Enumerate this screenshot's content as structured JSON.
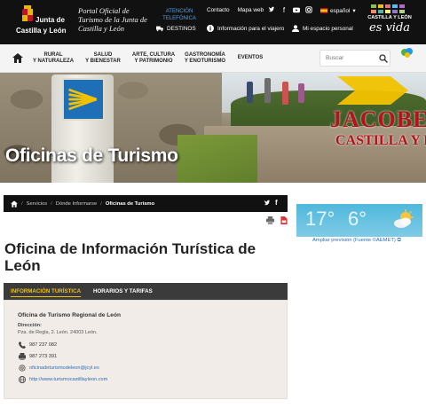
{
  "header": {
    "logo_line1": "Junta de",
    "logo_line2": "Castilla y León",
    "portal_text": "Portal Oficial de Turismo de la Junta de Castilla y León",
    "atencion": "ATENCIÓN TELEFÓNICA",
    "links": [
      "Contacto",
      "Mapa web"
    ],
    "language": "español",
    "destinos": "DESTINOS",
    "viajero": "Información para el viajero",
    "espacio": "Mi espacio personal",
    "brand_line1": "CASTILLA Y LEÓN",
    "brand_line2": "es vida",
    "social_icons": [
      "twitter-icon",
      "facebook-icon",
      "youtube-icon",
      "instagram-icon"
    ]
  },
  "menu": {
    "items": [
      {
        "line1": "RURAL",
        "line2": "Y NATURALEZA"
      },
      {
        "line1": "SALUD",
        "line2": "Y BIENESTAR"
      },
      {
        "line1": "ARTE, CULTURA",
        "line2": "Y PATRIMONIO"
      },
      {
        "line1": "GASTRONOMÍA",
        "line2": "Y ENOTURISMO"
      },
      {
        "line1": "EVENTOS",
        "line2": ""
      }
    ],
    "search_placeholder": "Buscar"
  },
  "hero": {
    "title": "Oficinas de Turismo",
    "banner_line1": "JACOBE",
    "banner_line2": "CASTILLA Y LEÓ"
  },
  "breadcrumb": {
    "items": [
      "Servicios",
      "Dónde Informarse",
      "Oficinas de Turismo"
    ]
  },
  "weather": {
    "temp_high": "17°",
    "temp_low": "6°",
    "link": "Ampliar previsión (Fuente ©AEMET)"
  },
  "page": {
    "heading": "Oficina de Información Turística de León"
  },
  "tabs": [
    {
      "label": "INFORMACIÓN TURÍSTICA",
      "active": true
    },
    {
      "label": "HORARIOS Y TARIFAS",
      "active": false
    }
  ],
  "office": {
    "name": "Oficina de Turismo Regional de León",
    "address_label": "Dirección:",
    "address": "Pza. de Regla, 2. León. 24003 León.",
    "phone": "987 237 082",
    "fax": "987 273 391",
    "email": "oficinadeturismodeleon@jcyl.es",
    "web": "http://www.turismocastillayleon.com"
  },
  "colors": {
    "topbar": "#111111",
    "accent_yellow": "#f2c200",
    "link_blue": "#2e6db0",
    "weather_blue": "#4fb8dc",
    "jacobeo_red": "#b5121b"
  }
}
